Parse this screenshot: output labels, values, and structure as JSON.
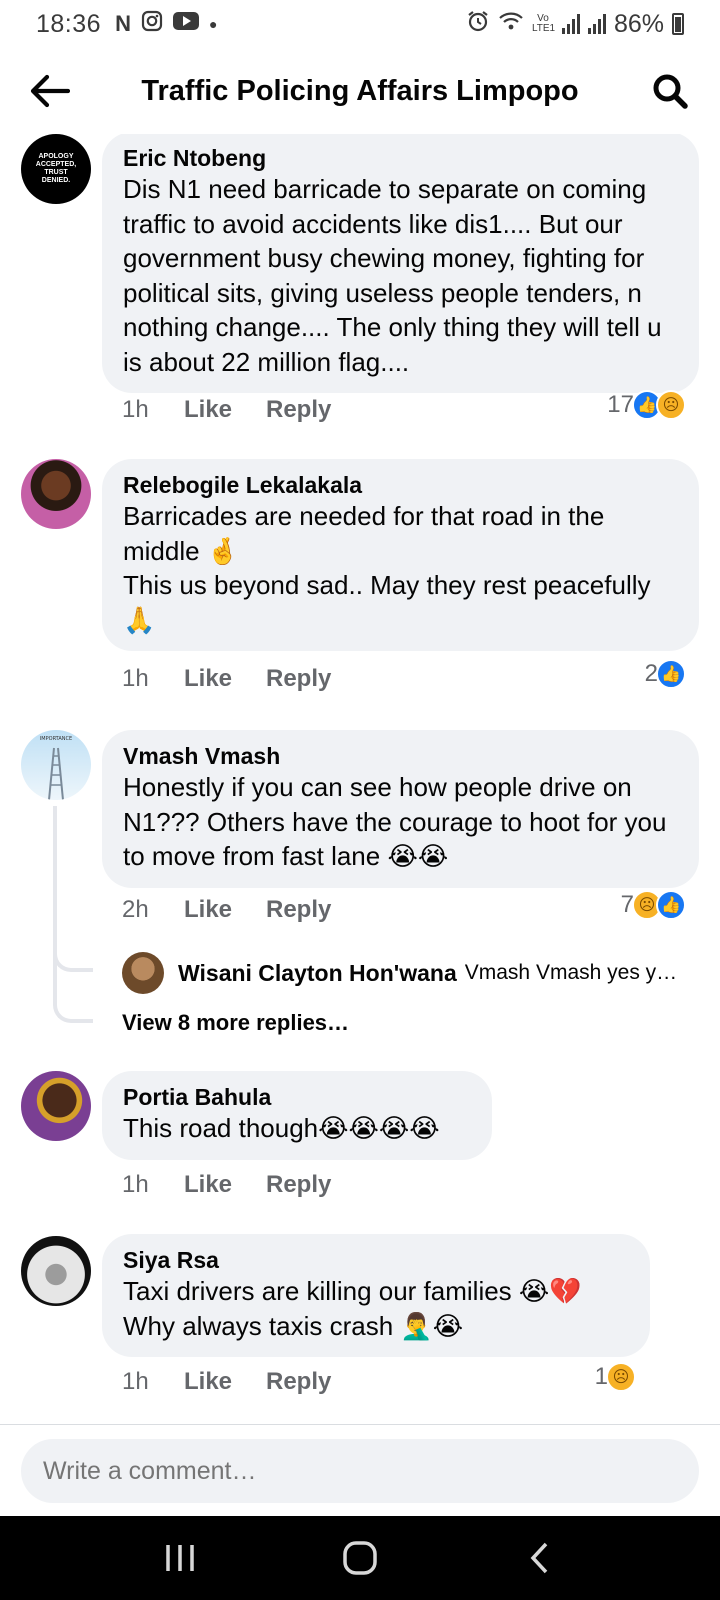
{
  "status_bar": {
    "time": "18:36",
    "battery": "86%",
    "network_label": "Vo LTE1"
  },
  "header": {
    "title": "Traffic Policing Affairs Limpopo"
  },
  "comments": [
    {
      "author": "Eric Ntobeng",
      "avatar_text": "APOLOGY ACCEPTED, TRUST DENIED.",
      "text": "Dis N1 need barricade to separate on coming traffic to avoid accidents like dis1.... But our government busy chewing money, fighting for political sits, giving useless people tenders, n nothing change.... The only thing they will tell u is about 22 million flag....",
      "time": "1h",
      "like_label": "Like",
      "reply_label": "Reply",
      "reaction_count": "17",
      "reactions": [
        "like",
        "sad"
      ]
    },
    {
      "author": "Relebogile Lekalakala",
      "text": "Barricades are needed for that road in the middle 🤞\nThis us beyond sad.. May they rest peacefully 🙏",
      "time": "1h",
      "like_label": "Like",
      "reply_label": "Reply",
      "reaction_count": "2",
      "reactions": [
        "like"
      ]
    },
    {
      "author": "Vmash Vmash",
      "avatar_text": "IMPORTANCE OF SMALL STEPS",
      "text": "Honestly if you can see how people drive on N1???  Others have the courage to hoot for you to move from fast lane 😭😭",
      "time": "2h",
      "like_label": "Like",
      "reply_label": "Reply",
      "reaction_count": "7",
      "reactions": [
        "sad",
        "like"
      ],
      "reply_preview": {
        "author": "Wisani Clayton Hon'wana",
        "text": "Vmash Vmash yes y…"
      },
      "view_more": "View 8 more replies…"
    },
    {
      "author": "Portia Bahula",
      "text": "This road though😭😭😭😭",
      "time": "1h",
      "like_label": "Like",
      "reply_label": "Reply"
    },
    {
      "author": "Siya Rsa",
      "text": "Taxi drivers are killing our families 😭💔\nWhy always taxis  crash 🤦‍♂️😭",
      "time": "1h",
      "like_label": "Like",
      "reply_label": "Reply",
      "reaction_count": "1",
      "reactions": [
        "sad"
      ]
    }
  ],
  "composer": {
    "placeholder": "Write a comment…"
  },
  "icons": {
    "back": "arrow-left-icon",
    "search": "search-icon",
    "like_reaction": "thumbs-up-icon",
    "sad_reaction": "sad-face-icon"
  },
  "colors": {
    "bubble": "#f0f2f5",
    "like_blue": "#1877f2",
    "secondary_text": "#65676b",
    "sad_yellow": "#f7b125"
  }
}
